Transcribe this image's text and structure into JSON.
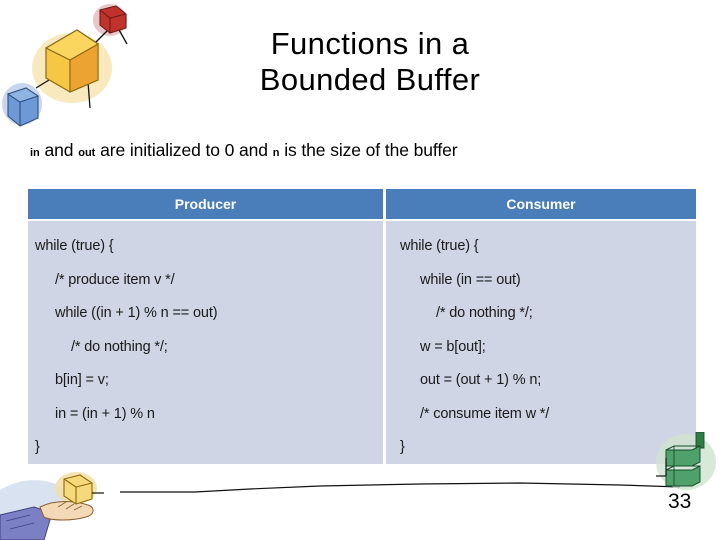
{
  "slide": {
    "title_line1": "Functions  in a",
    "title_line2": "Bounded Buffer",
    "subtitle": {
      "var_in": "in",
      "text_1": " and ",
      "var_out": "out",
      "text_2": " are initialized to 0 and ",
      "var_n": "n",
      "text_3": " is the size of the buffer"
    },
    "page_number": "33"
  },
  "table": {
    "headers": {
      "producer": "Producer",
      "consumer": "Consumer"
    },
    "producer_code": [
      "while (true) {",
      "/* produce item v */",
      "while ((in + 1) % n == out)",
      "/* do nothing */;",
      "b[in] = v;",
      "in = (in + 1) % n",
      "}"
    ],
    "consumer_code": [
      "while (true) {",
      "while (in == out)",
      "/* do nothing */;",
      "w = b[out];",
      "out = (out + 1) % n;",
      "/* consume item w */",
      "}"
    ]
  },
  "colors": {
    "header_blue": "#4a7ebb",
    "body_blue_gray": "#cfd5e4",
    "header_text": "#ffffff",
    "code_text": "#1a1a1a"
  },
  "decorations": {
    "top_left": "connected-boxes-clipart",
    "bottom_left": "hand-holding-box-clipart",
    "bottom_right": "green-boxes-clipart",
    "connector": "connector-line"
  }
}
